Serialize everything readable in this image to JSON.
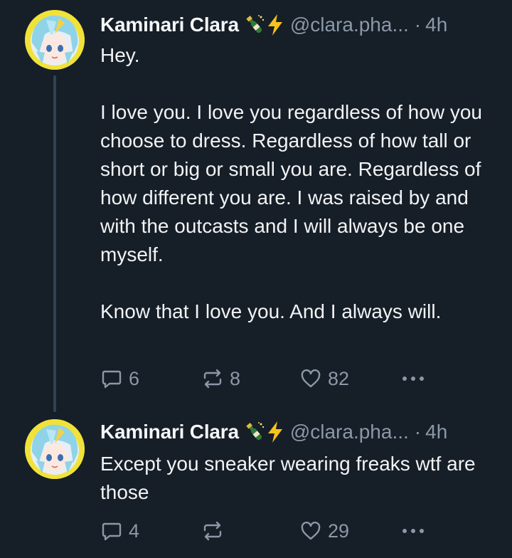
{
  "posts": [
    {
      "author_name": "Kaminari Clara",
      "author_emojis": [
        "champagne-bottle-icon",
        "lightning-bolt-icon"
      ],
      "handle": "@clara.pha...",
      "separator": "·",
      "time": "4h",
      "paragraphs": [
        "Hey.",
        "I love you. I love you regardless of how you choose to dress. Regardless of how tall or short or big or small you are. Regardless of how different you are. I was raised by and with the outcasts and I will always be one myself.",
        "Know that I love you. And I always will."
      ],
      "reply_count": "6",
      "repost_count": "8",
      "like_count": "82"
    },
    {
      "author_name": "Kaminari Clara",
      "author_emojis": [
        "champagne-bottle-icon",
        "lightning-bolt-icon"
      ],
      "handle": "@clara.pha...",
      "separator": "·",
      "time": "4h",
      "paragraphs": [
        "Except you sneaker wearing freaks wtf are those"
      ],
      "reply_count": "4",
      "repost_count": "",
      "like_count": "29"
    }
  ],
  "colors": {
    "background": "#161e27",
    "text": "#f1f3f5",
    "muted": "#8b98a8",
    "thread_line": "#2e4356",
    "avatar_ring": "#f1e23a"
  }
}
